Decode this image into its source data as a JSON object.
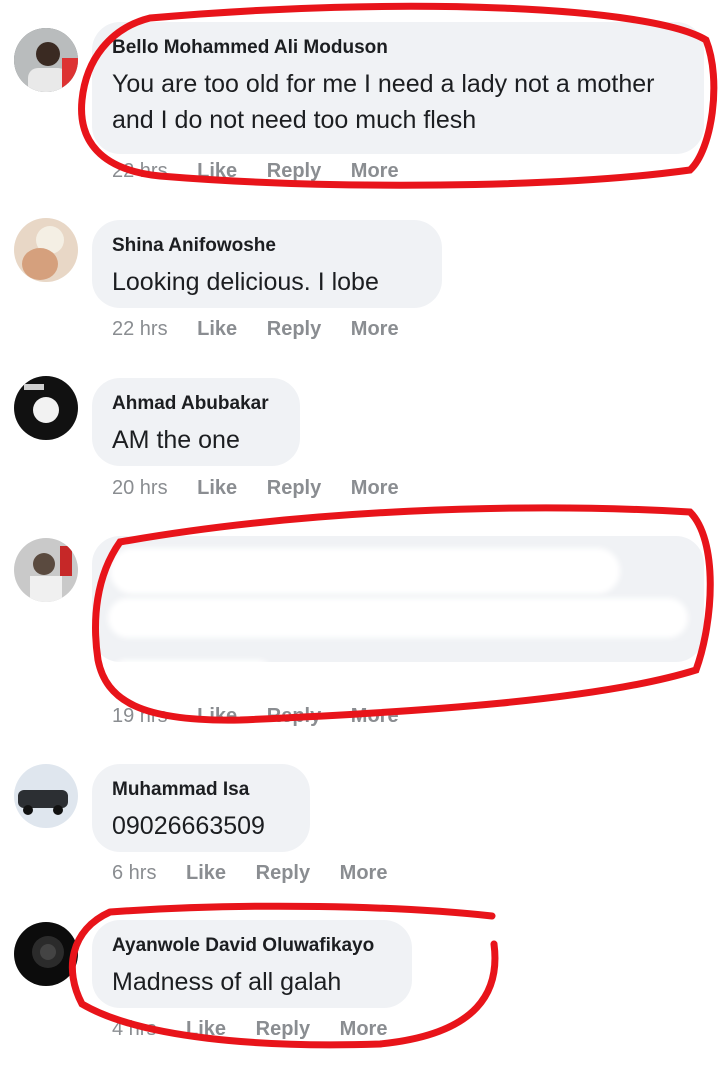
{
  "comments": [
    {
      "author": "Bello Mohammed Ali Moduson",
      "text": "You are too old for me I need a lady not a mother and I do not need too much flesh",
      "time": "22 hrs",
      "like": "Like",
      "reply": "Reply",
      "more": "More"
    },
    {
      "author": "Shina Anifowoshe",
      "text": "Looking delicious. I lobe",
      "time": "22 hrs",
      "like": "Like",
      "reply": "Reply",
      "more": "More"
    },
    {
      "author": "Ahmad Abubakar",
      "text": "AM the one",
      "time": "20 hrs",
      "like": "Like",
      "reply": "Reply",
      "more": "More"
    },
    {
      "author": "",
      "text": "",
      "time": "19 hrs",
      "like": "Like",
      "reply": "Reply",
      "more": "More"
    },
    {
      "author": "Muhammad Isa",
      "text": "09026663509",
      "time": "6 hrs",
      "like": "Like",
      "reply": "Reply",
      "more": "More"
    },
    {
      "author": "Ayanwole David Oluwafikayo",
      "text": "Madness of all galah",
      "time": "4 hrs",
      "like": "Like",
      "reply": "Reply",
      "more": "More"
    }
  ],
  "colors": {
    "bubble": "#f0f2f5",
    "meta": "#8a8d91",
    "annotation": "#e8141a"
  }
}
